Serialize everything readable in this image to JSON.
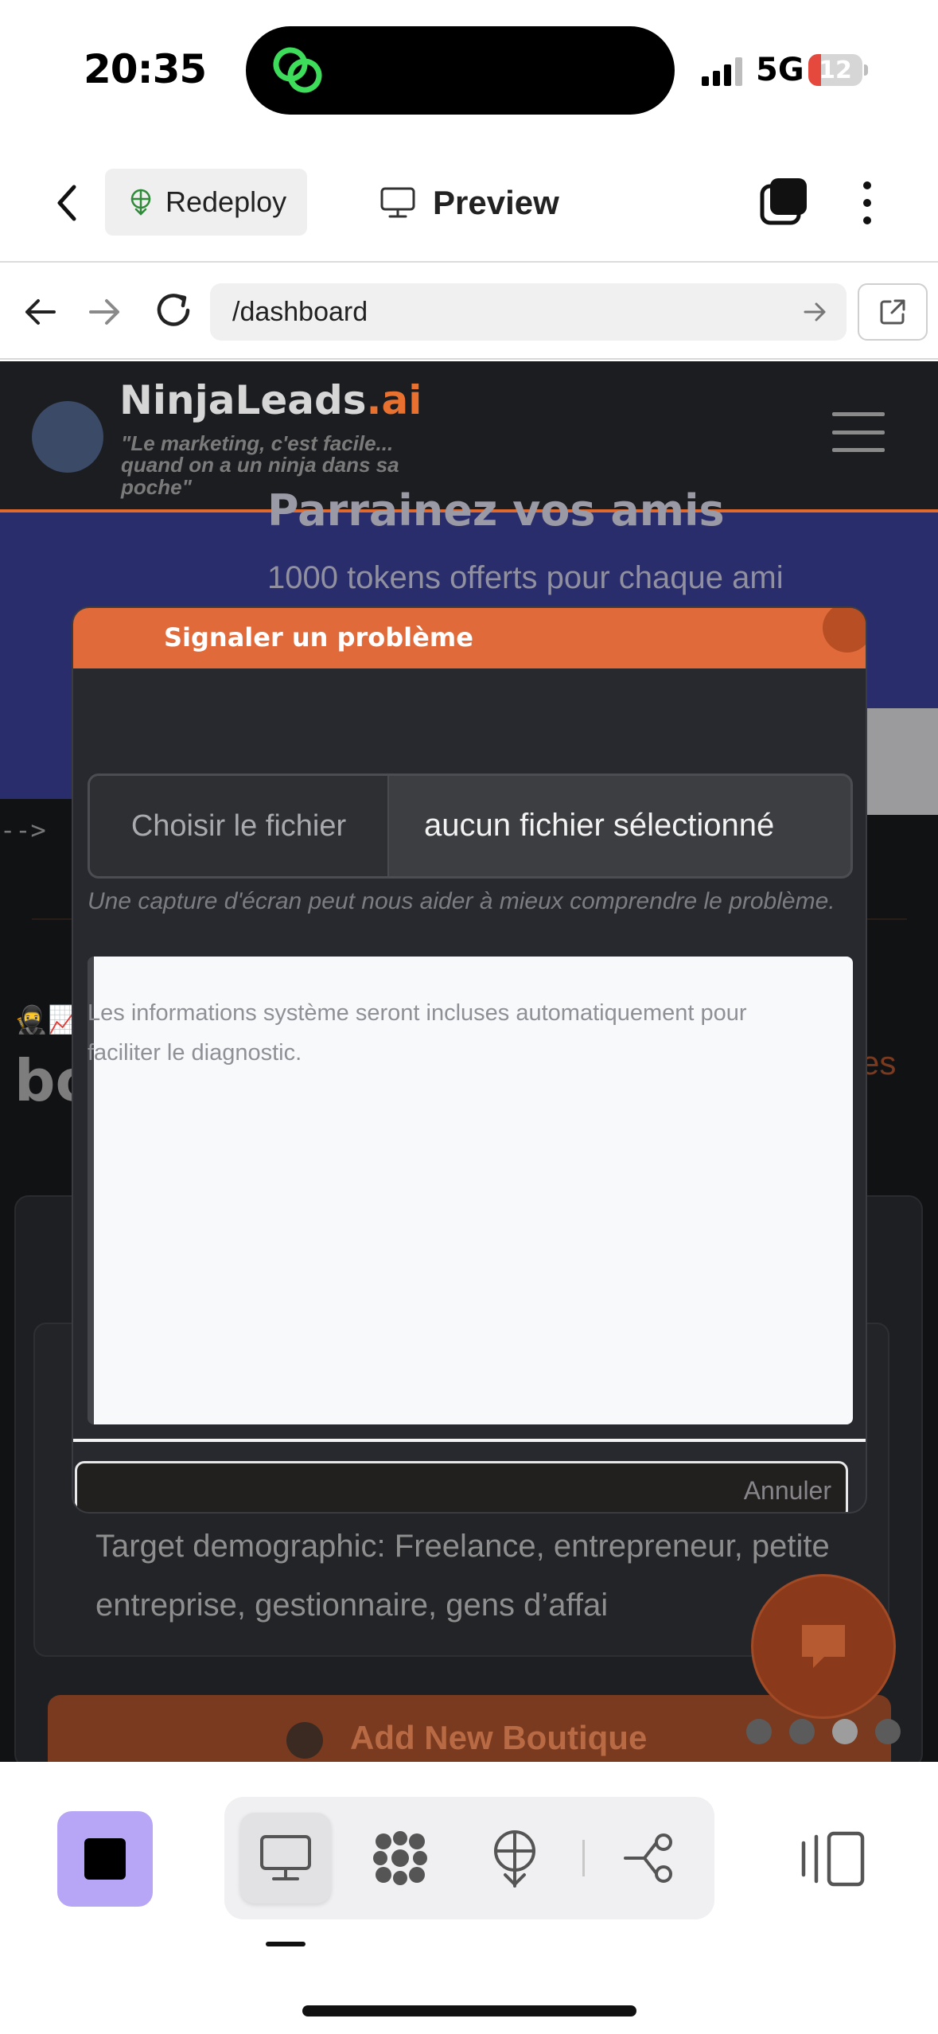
{
  "status_bar": {
    "time": "20:35",
    "network": "5G",
    "battery": "12"
  },
  "toolbar": {
    "redeploy_label": "Redeploy",
    "preview_label": "Preview"
  },
  "url_bar": {
    "url": "/dashboard"
  },
  "site": {
    "brand_main": "NinjaLeads",
    "brand_accent": ".ai",
    "tagline": "\"Le marketing, c'est facile... quand on a un ninja dans sa poche\"",
    "referral_title": "Parrainez vos amis",
    "referral_subtitle": "1000 tokens offerts pour chaque ami",
    "code_comment": "-->",
    "section_title": "bo",
    "section_link": "es",
    "target_demographic": "Target demographic: Freelance, entrepreneur, petite entreprise, gestionnaire, gens d’affai",
    "add_boutique_label": "Add New Boutique",
    "carousel": {
      "count": 4,
      "active_index": 2
    }
  },
  "modal": {
    "title": "Signaler un problème",
    "file_button_label": "Choisir le fichier",
    "file_status": "aucun fichier sélectionné",
    "file_hint": "Une capture d'écran peut nous aider à mieux comprendre le problème.",
    "system_info_note": "Les informations système seront incluses automatiquement pour faciliter le diagnostic.",
    "cancel_label": "Annuler"
  },
  "bottom_bar": {
    "items": [
      "stop-icon",
      "desktop-icon",
      "sparkle-icon",
      "deploy-icon",
      "workflow-icon",
      "panel-icon"
    ],
    "active": "desktop-icon"
  },
  "colors": {
    "accent_orange": "#e06a3a",
    "stop_purple": "#b7a6f5",
    "battery_red": "#e5483d",
    "referral_blue": "#2a2d6b"
  }
}
